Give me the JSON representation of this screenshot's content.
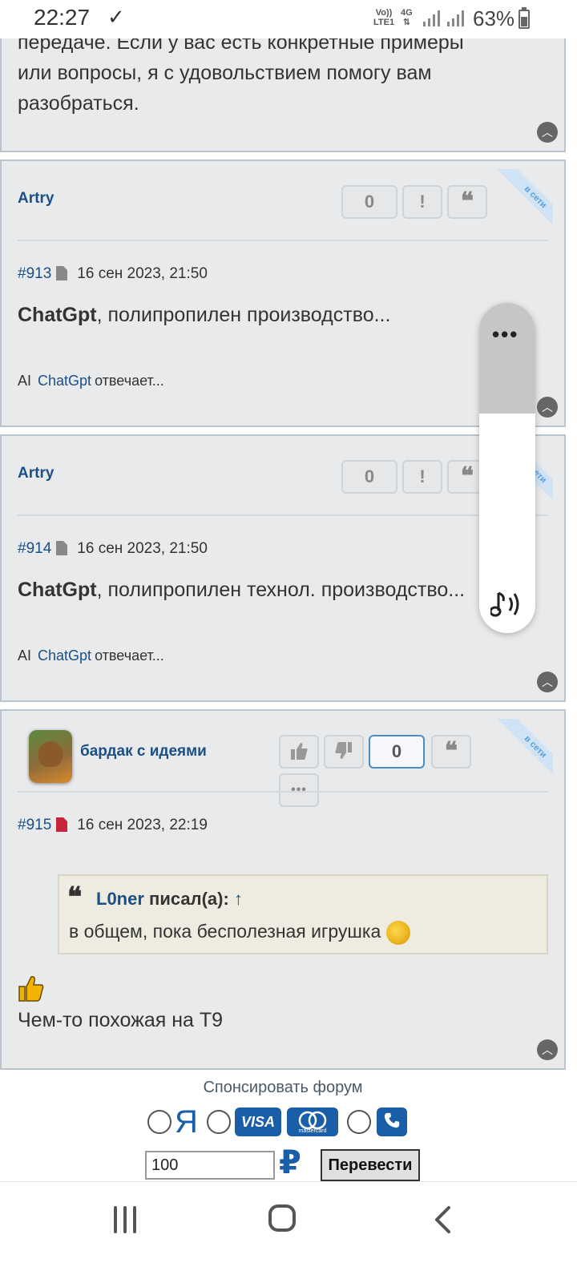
{
  "status_bar": {
    "time": "22:27",
    "check_icon": "download-done-icon",
    "volte": [
      "Vo))",
      "LTE1"
    ],
    "net_type": "4G",
    "battery_text": "63%"
  },
  "posts": [
    {
      "text_lines": [
        "передаче. Если у вас есть конкретные примеры",
        "или вопросы, я с удовольствием помогу вам",
        "разобраться."
      ]
    },
    {
      "author": "Artry",
      "likes": "0",
      "ribbon": "в сети",
      "number": "#913",
      "date": "16 сен 2023, 21:50",
      "body_bold": "ChatGpt",
      "body_rest": ", полипропилен производство...",
      "ai_prefix": "AI",
      "ai_user": "ChatGpt",
      "ai_status": "отвечает..."
    },
    {
      "author": "Artry",
      "likes": "0",
      "ribbon": "в сети",
      "number": "#914",
      "date": "16 сен 2023, 21:50",
      "body_bold": "ChatGpt",
      "body_rest": ", полипропилен технол. производство...",
      "ai_prefix": "AI",
      "ai_user": "ChatGpt",
      "ai_status": "отвечает..."
    },
    {
      "author": "бардак с идеями",
      "likes": "0",
      "ribbon": "в сети",
      "number": "#915",
      "date": "16 сен 2023, 22:19",
      "quote_user": "L0ner",
      "quote_wrote": "писал(а):",
      "quote_arrow": "↑",
      "quote_text": "в общем, пока бесполезная игрушка",
      "reply_text": "Чем-то похожая на Т9"
    }
  ],
  "sponsor": {
    "label": "Спонсировать форум",
    "yandex": "Я",
    "visa": "VISA",
    "mastercard": "mastercard",
    "amount": "100",
    "currency": "₽",
    "submit": "Перевести"
  },
  "colors": {
    "link": "#1b4f86",
    "post_bg": "#e9eaeb",
    "quote_bg": "#eeece0"
  }
}
